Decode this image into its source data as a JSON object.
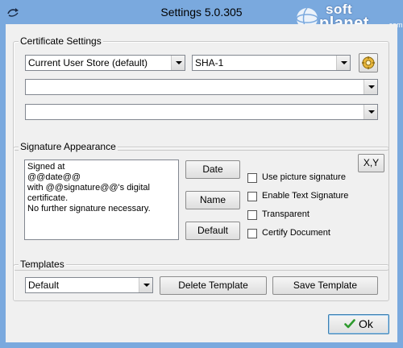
{
  "window": {
    "title": "Settings 5.0.305",
    "watermark": {
      "soft": "soft",
      "planet": "planet",
      "com": ".com"
    }
  },
  "certificate": {
    "legend": "Certificate Settings",
    "store": "Current User Store (default)",
    "hash": "SHA-1",
    "combo2": "",
    "combo3": ""
  },
  "signature": {
    "legend": "Signature Appearance",
    "text": "Signed at\n@@date@@\nwith @@signature@@'s digital\ncertificate.\nNo further signature necessary.",
    "date_button": "Date",
    "name_button": "Name",
    "default_button": "Default",
    "xy_button": "X,Y",
    "use_picture": "Use picture signature",
    "enable_text": "Enable Text Signature",
    "transparent": "Transparent",
    "certify": "Certify Document"
  },
  "templates": {
    "legend": "Templates",
    "selected": "Default",
    "delete_button": "Delete Template",
    "save_button": "Save Template"
  },
  "footer": {
    "ok_button": "Ok"
  },
  "colors": {
    "titlebar": "#7aa9de",
    "client": "#f0f0f0",
    "ok_check": "#2e9a2e"
  }
}
